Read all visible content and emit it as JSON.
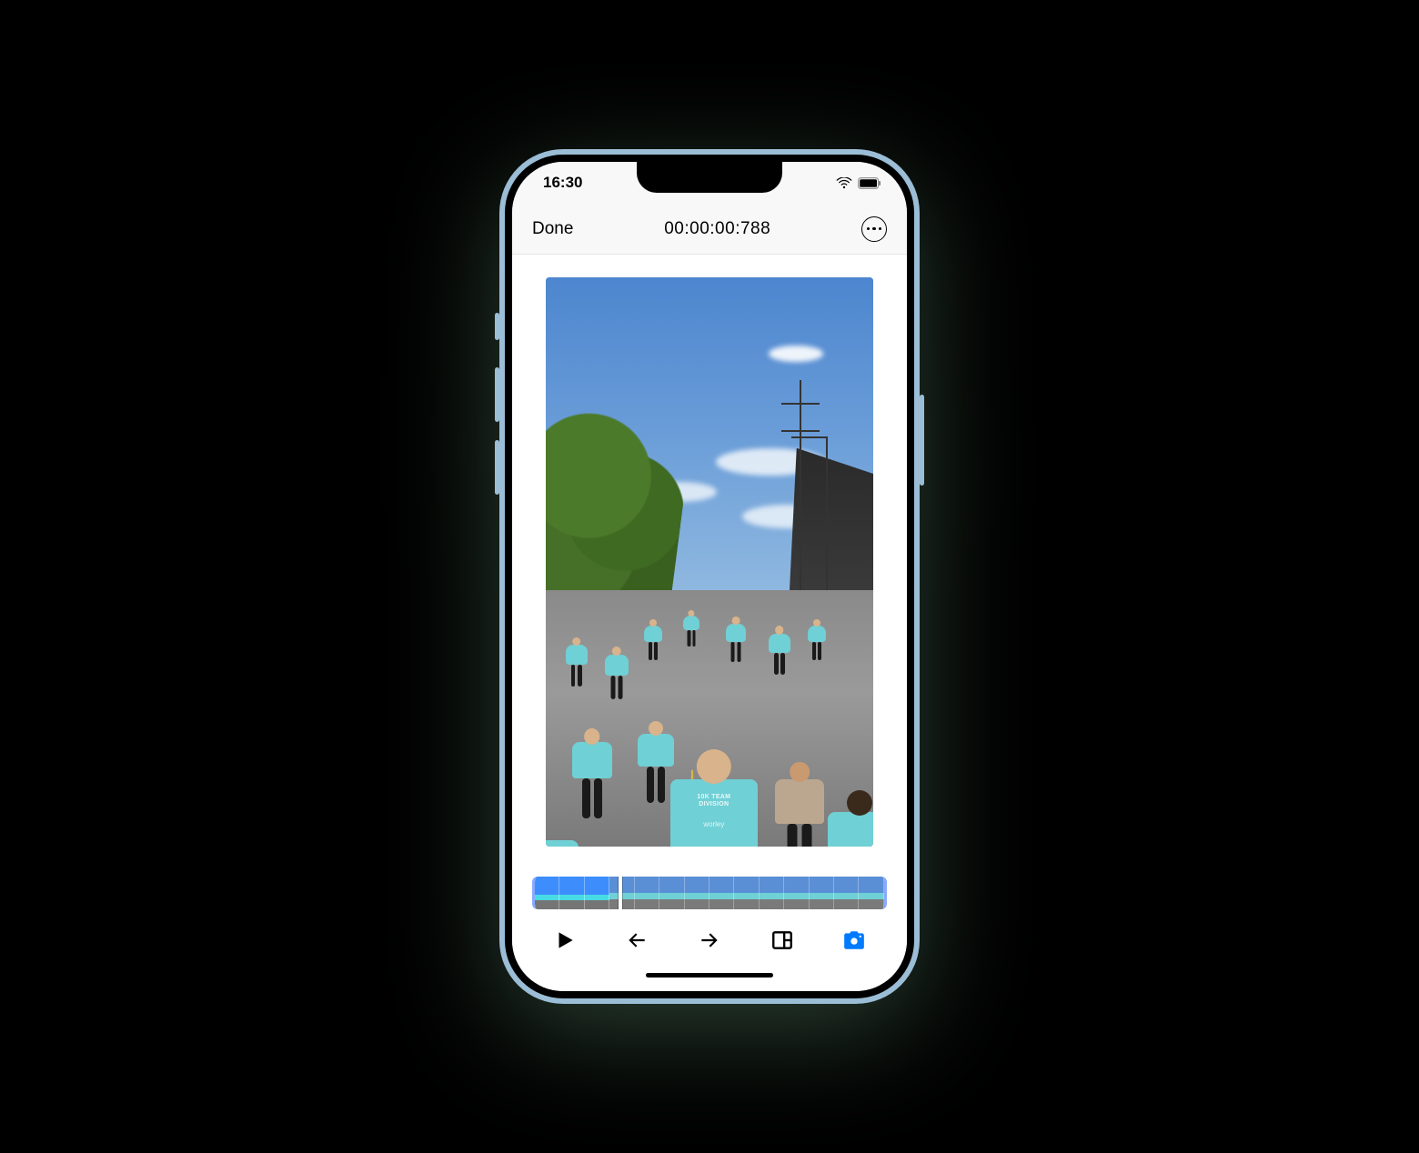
{
  "statusbar": {
    "time": "16:30"
  },
  "header": {
    "done_label": "Done",
    "timecode": "00:00:00:788"
  },
  "preview": {
    "shirt_line1": "10K TEAM",
    "shirt_line2": "DIVISION",
    "shirt_logo": "worley"
  },
  "timeline": {
    "frame_count": 14,
    "playhead_percent": 24
  },
  "toolbar": {
    "play": "Play",
    "prev": "Previous frame",
    "next": "Next frame",
    "aspect": "Aspect tool",
    "camera": "Camera capture"
  },
  "colors": {
    "accent": "#007aff",
    "shirt": "#6fd0d5"
  }
}
